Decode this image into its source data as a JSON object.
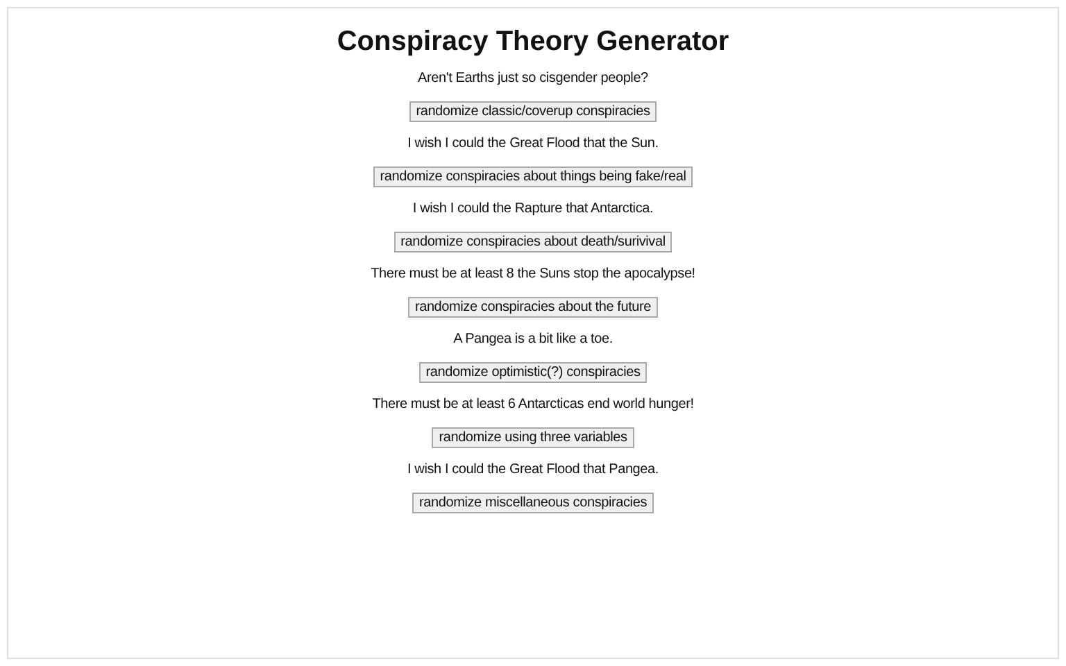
{
  "title": "Conspiracy Theory Generator",
  "sections": [
    {
      "sentence": "Aren't Earths just so cisgender people?",
      "button": "randomize classic/coverup conspiracies"
    },
    {
      "sentence": "I wish I could the Great Flood that the Sun.",
      "button": "randomize conspiracies about things being fake/real"
    },
    {
      "sentence": "I wish I could the Rapture that Antarctica.",
      "button": "randomize conspiracies about death/surivival"
    },
    {
      "sentence": "There must be at least 8 the Suns stop the apocalypse!",
      "button": "randomize conspiracies about the future"
    },
    {
      "sentence": "A Pangea is a bit like a toe.",
      "button": "randomize optimistic(?) conspiracies"
    },
    {
      "sentence": "There must be at least 6 Antarcticas end world hunger!",
      "button": "randomize using three variables"
    },
    {
      "sentence": "I wish I could the Great Flood that Pangea.",
      "button": "randomize miscellaneous conspiracies"
    }
  ]
}
